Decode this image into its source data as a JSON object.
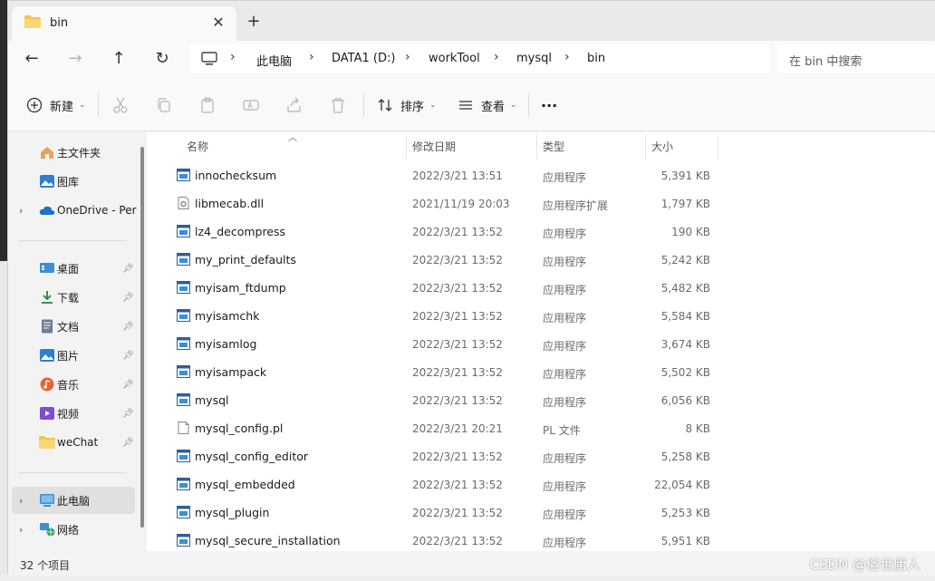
{
  "tab": {
    "title": "bin",
    "close": "✕",
    "new_tab": "+"
  },
  "nav": {
    "back": "←",
    "forward": "→",
    "up": "↑",
    "refresh": "↻"
  },
  "breadcrumbs": [
    "此电脑",
    "DATA1 (D:)",
    "workTool",
    "mysql",
    "bin"
  ],
  "breadcrumb_separator": "›",
  "search": {
    "placeholder": "在 bin 中搜索"
  },
  "commands": {
    "new": "新建",
    "sort": "排序",
    "view": "查看",
    "more": "···"
  },
  "sidebar": {
    "items": [
      {
        "label": "主文件夹",
        "icon": "home-icon"
      },
      {
        "label": "图库",
        "icon": "gallery-icon"
      },
      {
        "label": "OneDrive - Per",
        "icon": "cloud-icon"
      },
      {
        "label": "桌面",
        "icon": "desktop-icon"
      },
      {
        "label": "下载",
        "icon": "download-icon"
      },
      {
        "label": "文档",
        "icon": "document-icon"
      },
      {
        "label": "图片",
        "icon": "pictures-icon"
      },
      {
        "label": "音乐",
        "icon": "music-icon"
      },
      {
        "label": "视频",
        "icon": "video-icon"
      },
      {
        "label": "weChat",
        "icon": "folder-icon"
      },
      {
        "label": "此电脑",
        "icon": "computer-icon"
      },
      {
        "label": "网络",
        "icon": "network-icon"
      }
    ]
  },
  "columns": {
    "name": "名称",
    "date": "修改日期",
    "type": "类型",
    "size": "大小"
  },
  "files": [
    {
      "name": "innochecksum",
      "date": "2022/3/21 13:51",
      "type": "应用程序",
      "size": "5,391 KB",
      "icon": "exe"
    },
    {
      "name": "libmecab.dll",
      "date": "2021/11/19 20:03",
      "type": "应用程序扩展",
      "size": "1,797 KB",
      "icon": "dll"
    },
    {
      "name": "lz4_decompress",
      "date": "2022/3/21 13:52",
      "type": "应用程序",
      "size": "190 KB",
      "icon": "exe"
    },
    {
      "name": "my_print_defaults",
      "date": "2022/3/21 13:52",
      "type": "应用程序",
      "size": "5,242 KB",
      "icon": "exe"
    },
    {
      "name": "myisam_ftdump",
      "date": "2022/3/21 13:52",
      "type": "应用程序",
      "size": "5,482 KB",
      "icon": "exe"
    },
    {
      "name": "myisamchk",
      "date": "2022/3/21 13:52",
      "type": "应用程序",
      "size": "5,584 KB",
      "icon": "exe"
    },
    {
      "name": "myisamlog",
      "date": "2022/3/21 13:52",
      "type": "应用程序",
      "size": "3,674 KB",
      "icon": "exe"
    },
    {
      "name": "myisampack",
      "date": "2022/3/21 13:52",
      "type": "应用程序",
      "size": "5,502 KB",
      "icon": "exe"
    },
    {
      "name": "mysql",
      "date": "2022/3/21 13:52",
      "type": "应用程序",
      "size": "6,056 KB",
      "icon": "exe"
    },
    {
      "name": "mysql_config.pl",
      "date": "2022/3/21 20:21",
      "type": "PL 文件",
      "size": "8 KB",
      "icon": "file"
    },
    {
      "name": "mysql_config_editor",
      "date": "2022/3/21 13:52",
      "type": "应用程序",
      "size": "5,258 KB",
      "icon": "exe"
    },
    {
      "name": "mysql_embedded",
      "date": "2022/3/21 13:52",
      "type": "应用程序",
      "size": "22,054 KB",
      "icon": "exe"
    },
    {
      "name": "mysql_plugin",
      "date": "2022/3/21 13:52",
      "type": "应用程序",
      "size": "5,253 KB",
      "icon": "exe"
    },
    {
      "name": "mysql_secure_installation",
      "date": "2022/3/21 13:52",
      "type": "应用程序",
      "size": "5,951 KB",
      "icon": "exe"
    }
  ],
  "status": {
    "item_count": "32 个项目"
  },
  "watermark": "CSDN @俗世庸人"
}
